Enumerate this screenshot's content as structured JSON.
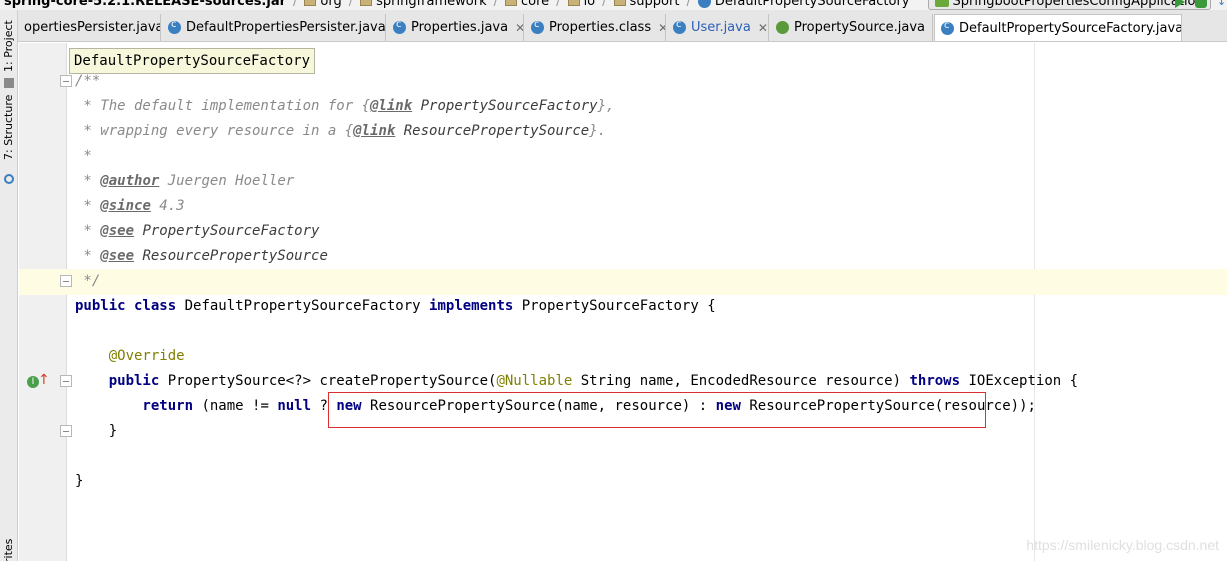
{
  "breadcrumb": {
    "items": [
      "spring-core-5.2.1.RELEASE-sources.jar",
      "org",
      "springframework",
      "core",
      "io",
      "support",
      "DefaultPropertySourceFactory"
    ],
    "run_config": "SpringbootPropertiesConfigApplication"
  },
  "tabs": [
    {
      "label": "opertiesPersister.java",
      "icon": "java-class-icon",
      "active": false,
      "modified": false
    },
    {
      "label": "DefaultPropertiesPersister.java",
      "icon": "java-class-icon",
      "active": false,
      "modified": false
    },
    {
      "label": "Properties.java",
      "icon": "java-class-icon",
      "active": false,
      "modified": false
    },
    {
      "label": "Properties.class",
      "icon": "java-class-icon",
      "active": false,
      "modified": false
    },
    {
      "label": "User.java",
      "icon": "java-class-icon",
      "active": false,
      "modified": true
    },
    {
      "label": "PropertySource.java",
      "icon": "java-class-icon",
      "active": false,
      "modified": false
    },
    {
      "label": "DefaultPropertySourceFactory.java",
      "icon": "java-class-icon",
      "active": true,
      "modified": false
    }
  ],
  "left_strip": {
    "project": "1: Project",
    "structure": "7: Structure",
    "favorites": "rites"
  },
  "tooltip": "DefaultPropertySourceFactory",
  "code": {
    "doc_open": "/**",
    "doc_line1_pre": " * The default implementation for {",
    "doc_line1_tag": "@link",
    "doc_line1_ref": " PropertySourceFactory",
    "doc_line1_post": "},",
    "doc_line2_pre": " * wrapping every resource in a {",
    "doc_line2_tag": "@link",
    "doc_line2_ref": " ResourcePropertySource",
    "doc_line2_post": "}.",
    "doc_blank": " *",
    "author_pre": " * ",
    "author_tag": "@author",
    "author_val": " Juergen Hoeller",
    "since_pre": " * ",
    "since_tag": "@since",
    "since_val": " 4.3",
    "see1_pre": " * ",
    "see1_tag": "@see",
    "see1_val": " PropertySourceFactory",
    "see2_pre": " * ",
    "see2_tag": "@see",
    "see2_val": " ResourcePropertySource",
    "doc_close": " */",
    "class_kw1": "public",
    "class_kw2": " class",
    "class_name": " DefaultPropertySourceFactory ",
    "class_kw3": "implements",
    "class_rest": " PropertySourceFactory {",
    "override": "    @Override",
    "method_kw": "    public",
    "method_sig1": " PropertySource<?> createPropertySource(",
    "method_ann": "@Nullable",
    "method_sig2": " String name, EncodedResource resource) ",
    "method_throws": "throws",
    "method_sig3": " IOException {",
    "ret_kw": "        return",
    "ret_mid1": " (name != ",
    "ret_null": "null",
    "ret_mid2": " ? ",
    "ret_new1": "new",
    "ret_mid3": " ResourcePropertySource(name, resource) : ",
    "ret_new2": "new",
    "ret_mid4": " ResourcePropertySource(resource));",
    "method_close": "    }",
    "class_close": "}"
  },
  "watermark": "https://smilenicky.blog.csdn.net"
}
